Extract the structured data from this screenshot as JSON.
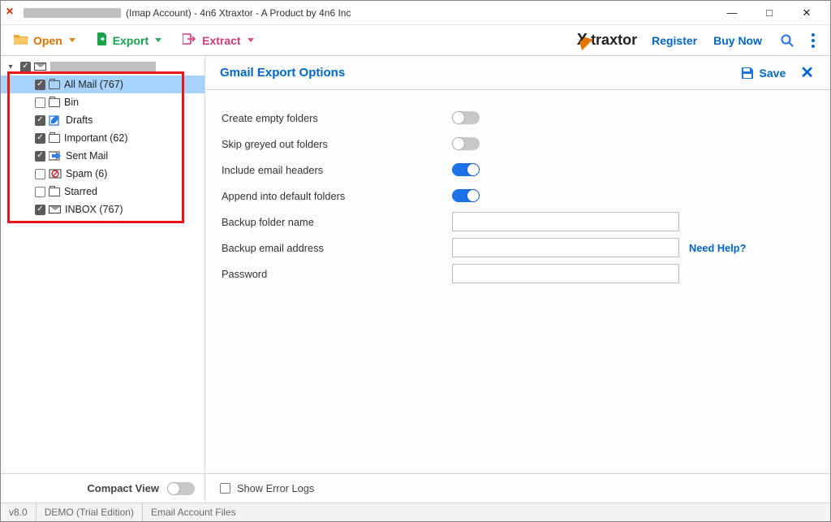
{
  "window": {
    "title_suffix": "(Imap Account) - 4n6 Xtraxtor - A Product by 4n6 Inc"
  },
  "toolbar": {
    "open": "Open",
    "export": "Export",
    "extract": "Extract",
    "register": "Register",
    "buy_now": "Buy Now",
    "logo_text": "traxtor"
  },
  "sidebar": {
    "root": {
      "checked": true,
      "expanded": true
    },
    "items": [
      {
        "label": "All Mail",
        "count": "(767)",
        "checked": true,
        "icon": "folder",
        "selected": true
      },
      {
        "label": "Bin",
        "count": "",
        "checked": false,
        "icon": "folder"
      },
      {
        "label": "Drafts",
        "count": "",
        "checked": true,
        "icon": "draft"
      },
      {
        "label": "Important",
        "count": "(62)",
        "checked": true,
        "icon": "folder"
      },
      {
        "label": "Sent Mail",
        "count": "",
        "checked": true,
        "icon": "sent"
      },
      {
        "label": "Spam",
        "count": "(6)",
        "checked": false,
        "icon": "spam"
      },
      {
        "label": "Starred",
        "count": "",
        "checked": false,
        "icon": "folder"
      },
      {
        "label": "INBOX",
        "count": "(767)",
        "checked": true,
        "icon": "mail"
      }
    ],
    "compact_view": "Compact View",
    "compact_view_on": false
  },
  "content": {
    "title": "Gmail Export Options",
    "save": "Save",
    "toggles": [
      {
        "label": "Create empty folders",
        "on": false
      },
      {
        "label": "Skip greyed out folders",
        "on": false
      },
      {
        "label": "Include email headers",
        "on": true
      },
      {
        "label": "Append into default folders",
        "on": true
      }
    ],
    "fields": [
      {
        "label": "Backup folder name",
        "value": "",
        "help": ""
      },
      {
        "label": "Backup email address",
        "value": "",
        "help": "Need Help?"
      },
      {
        "label": "Password",
        "value": "",
        "help": ""
      }
    ],
    "show_error_logs": {
      "label": "Show Error Logs",
      "checked": false
    }
  },
  "statusbar": {
    "version": "v8.0",
    "edition": "DEMO (Trial Edition)",
    "path_label": "Email Account Files"
  }
}
